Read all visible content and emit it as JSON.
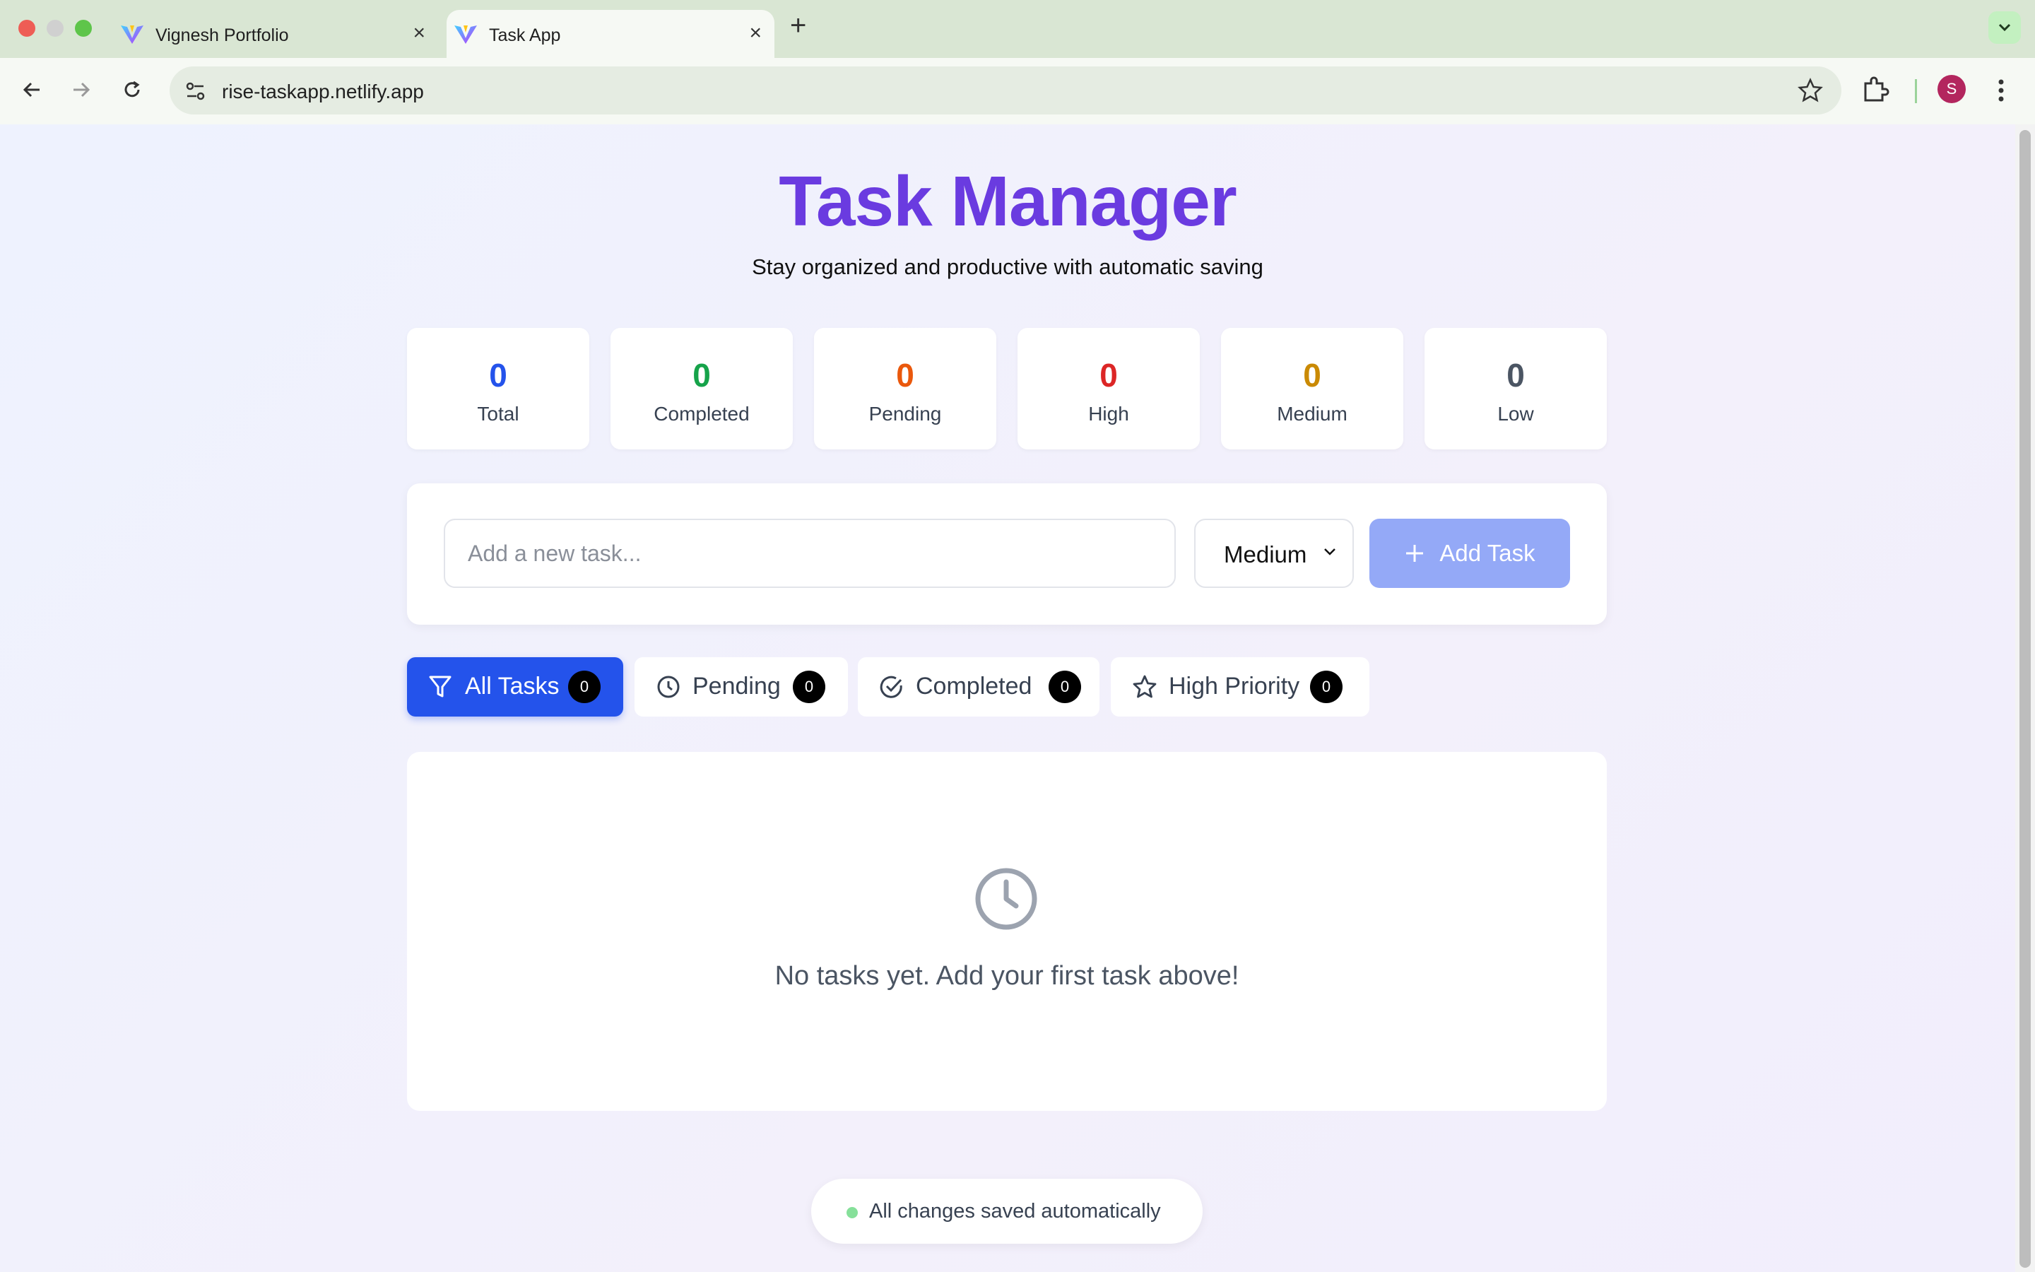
{
  "browser": {
    "tabs": [
      {
        "title": "Vignesh Portfolio",
        "active": false
      },
      {
        "title": "Task App",
        "active": true
      }
    ],
    "url": "rise-taskapp.netlify.app",
    "profile_initial": "S"
  },
  "app": {
    "title": "Task Manager",
    "subtitle": "Stay organized and productive with automatic saving"
  },
  "stats": [
    {
      "value": "0",
      "label": "Total",
      "color": "#2453eb"
    },
    {
      "value": "0",
      "label": "Completed",
      "color": "#16a34a"
    },
    {
      "value": "0",
      "label": "Pending",
      "color": "#ea580c"
    },
    {
      "value": "0",
      "label": "High",
      "color": "#dc2626"
    },
    {
      "value": "0",
      "label": "Medium",
      "color": "#ca8a04"
    },
    {
      "value": "0",
      "label": "Low",
      "color": "#4b5563"
    }
  ],
  "add_form": {
    "placeholder": "Add a new task...",
    "priority_selected": "Medium",
    "add_label": "Add Task"
  },
  "filters": [
    {
      "label": "All Tasks",
      "count": "0",
      "icon": "filter-icon",
      "active": true
    },
    {
      "label": "Pending",
      "count": "0",
      "icon": "clock-icon",
      "active": false
    },
    {
      "label": "Completed",
      "count": "0",
      "icon": "check-circle-icon",
      "active": false
    },
    {
      "label": "High Priority",
      "count": "0",
      "icon": "star-icon",
      "active": false
    }
  ],
  "empty_state": {
    "icon": "clock-icon",
    "message": "No tasks yet. Add your first task above!"
  },
  "save_status": "All changes saved automatically",
  "colors": {
    "accent": "#2453eb",
    "title": "#6a3be0",
    "add_button_disabled": "#94a9f7",
    "saved_dot": "#86e09a"
  }
}
